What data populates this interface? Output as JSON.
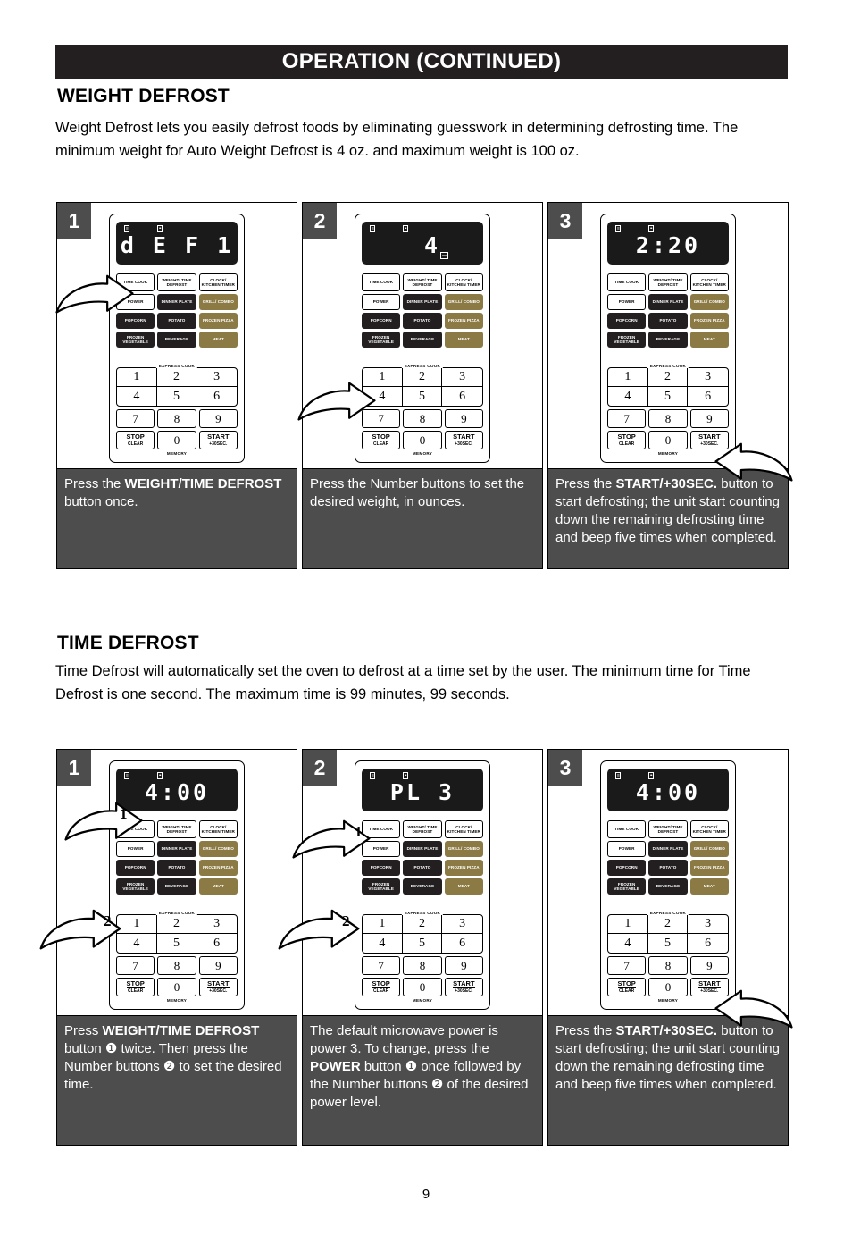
{
  "header": {
    "title": "OPERATION  (CONTINUED)"
  },
  "page_number": "9",
  "sections": [
    {
      "title": "WEIGHT DEFROST",
      "body": "Weight Defrost lets you easily defrost foods by eliminating guesswork in determining defrosting time. The minimum weight for Auto Weight Defrost is 4 oz. and maximum weight is 100 oz.",
      "steps": [
        {
          "badge": "1",
          "display": "d E F 1",
          "caption_parts": [
            {
              "text": "Press    the    ",
              "bold": false
            },
            {
              "text": "WEIGHT/TIME DEFROST",
              "bold": true
            },
            {
              "text": " button once.",
              "bold": false
            }
          ],
          "arrows": [
            {
              "label": "",
              "target": "weight-time-defrost-button"
            }
          ]
        },
        {
          "badge": "2",
          "display": "4",
          "caption_parts": [
            {
              "text": "Press the Number buttons to set the desired weight, in ounces.",
              "bold": false
            }
          ],
          "arrows": [
            {
              "label": "",
              "target": "number-key-4"
            }
          ]
        },
        {
          "badge": "3",
          "display": "2:20",
          "caption_parts": [
            {
              "text": "Press    the    ",
              "bold": false
            },
            {
              "text": "START/+30SEC.",
              "bold": true
            },
            {
              "text": " button to start defrosting; the unit start counting down the remaining defrosting time and beep five times when completed.",
              "bold": false
            }
          ],
          "arrows": [
            {
              "label": "",
              "target": "start-30sec-button"
            }
          ]
        }
      ]
    },
    {
      "title": "TIME DEFROST",
      "body": "Time Defrost will automatically set the oven to defrost at a time set by the user. The minimum time for Time Defrost is one second. The maximum time is 99 minutes, 99 seconds.",
      "steps": [
        {
          "badge": "1",
          "display": "4:00",
          "caption_parts": [
            {
              "text": " Press ",
              "bold": false
            },
            {
              "text": "WEIGHT/TIME DEFROST",
              "bold": true
            },
            {
              "text": " button  ❶  twice. Then press the Number buttons ❷ to  set  the desired time.",
              "bold": false
            }
          ],
          "arrows": [
            {
              "label": "1",
              "target": "weight-time-defrost-button"
            },
            {
              "label": "2",
              "target": "number-key-4"
            }
          ]
        },
        {
          "badge": "2",
          "display": "PL   3",
          "caption_parts": [
            {
              "text": "The default microwave power is power 3. To  change,  press the  ",
              "bold": false
            },
            {
              "text": "POWER",
              "bold": true
            },
            {
              "text": "  button ❶  once followed by the Number buttons ❷  of the desired power level.",
              "bold": false
            }
          ],
          "arrows": [
            {
              "label": "1",
              "target": "power-button"
            },
            {
              "label": "2",
              "target": "number-key-4"
            }
          ]
        },
        {
          "badge": "3",
          "display": "4:00",
          "caption_parts": [
            {
              "text": "Press    the    ",
              "bold": false
            },
            {
              "text": "START/+30SEC.",
              "bold": true
            },
            {
              "text": " button to start defrosting; the unit start counting down the remaining defrosting time and beep five times when completed.",
              "bold": false
            }
          ],
          "arrows": [
            {
              "label": "",
              "target": "start-30sec-button"
            }
          ]
        }
      ]
    }
  ],
  "control_panel": {
    "function_buttons": [
      {
        "label": "TIME COOK",
        "style": "white"
      },
      {
        "label": "WEIGHT/ TIME DEFROST",
        "style": "white"
      },
      {
        "label": "CLOCK/ KITCHEN TIMER",
        "style": "white"
      },
      {
        "label": "POWER",
        "style": "white"
      },
      {
        "label": "DINNER PLATE",
        "style": "black"
      },
      {
        "label": "GRILL/ COMBO",
        "style": "gold"
      },
      {
        "label": "POPCORN",
        "style": "black"
      },
      {
        "label": "POTATO",
        "style": "black"
      },
      {
        "label": "FROZEN PIZZA",
        "style": "gold"
      },
      {
        "label": "FROZEN VEGETABLE",
        "style": "black"
      },
      {
        "label": "BEVERAGE",
        "style": "black"
      },
      {
        "label": "MEAT",
        "style": "gold"
      }
    ],
    "express_cook_label": "EXPRESS COOK",
    "express_keys_top": [
      "1",
      "2",
      "3"
    ],
    "express_keys_bottom": [
      "4",
      "5",
      "6"
    ],
    "keys_row_7_9": [
      "7",
      "8",
      "9"
    ],
    "stop_key": {
      "line1": "STOP",
      "line2": "CLEAR"
    },
    "zero_key": "0",
    "start_key": {
      "line1": "START",
      "line2": "+30SEC."
    },
    "memory_label": "MEMORY",
    "display_indicators": {
      "left": "▬▬",
      "right": "▪▪"
    }
  },
  "colors": {
    "header_bg": "#231f20",
    "caption_bg": "#4d4d4d",
    "badge_bg": "#4d4d4d",
    "gold_button": "#8c7a45",
    "black_button": "#231f20"
  }
}
